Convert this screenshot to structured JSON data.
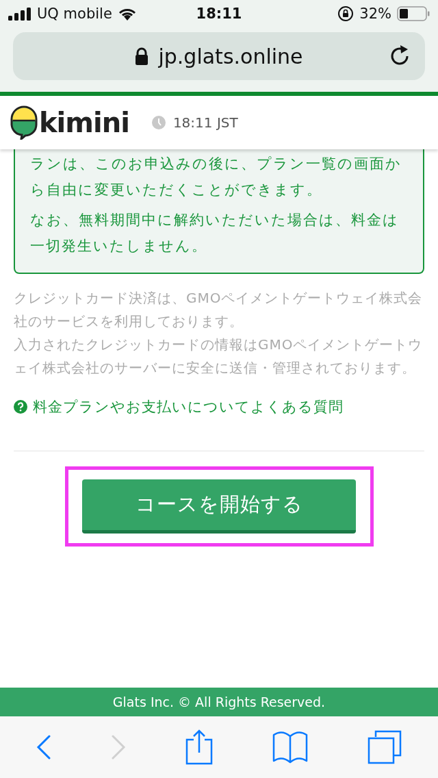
{
  "status_bar": {
    "carrier": "UQ mobile",
    "time": "18:11",
    "battery": "32%"
  },
  "address_bar": {
    "url": "jp.glats.online"
  },
  "header": {
    "logo": "kimini",
    "clock": "18:11 JST"
  },
  "notice": [
    "ランは、このお申込みの後に、プラン一覧の画面から自由に変更いただくことができます。",
    "なお、無料期間中に解約いただいた場合は、料金は一切発生いたしません。"
  ],
  "payment_info": [
    "クレジットカード決済は、GMOペイメントゲートウェイ株式会社のサービスを利用しております。",
    "入力されたクレジットカードの情報はGMOペイメントゲートウェイ株式会社のサーバーに安全に送信・管理されております。"
  ],
  "faq_link": "料金プランやお支払いについてよくある質問",
  "start_button": "コースを開始する",
  "footer": "Glats Inc. © All Rights Reserved.",
  "toolbar": [
    {
      "kind": "back",
      "disabled": false
    },
    {
      "kind": "forward",
      "disabled": true
    },
    {
      "kind": "share",
      "disabled": false
    },
    {
      "kind": "bookmarks",
      "disabled": false
    },
    {
      "kind": "tabs",
      "disabled": false
    }
  ]
}
